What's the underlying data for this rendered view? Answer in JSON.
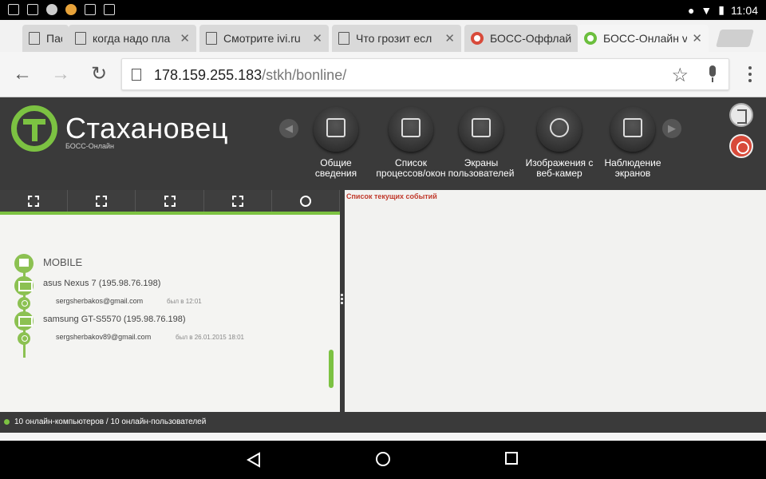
{
  "statusbar": {
    "time": "11:04"
  },
  "tabs": [
    {
      "title": "Пас",
      "active": false,
      "favicon": "page-icon"
    },
    {
      "title": "когда надо пла",
      "active": false,
      "favicon": "page-icon"
    },
    {
      "title": "Смотрите ivi.ru",
      "active": false,
      "favicon": "page-icon"
    },
    {
      "title": "Что грозит есл",
      "active": false,
      "favicon": "page-icon"
    },
    {
      "title": "БОСС-Оффлайн",
      "active": false,
      "favicon": "boss-icon"
    },
    {
      "title": "БОСС-Онлайн v",
      "active": true,
      "favicon": "boss-icon"
    }
  ],
  "toolbar": {
    "url_host": "178.159.255.183",
    "url_path": "/stkh/bonline/"
  },
  "header": {
    "logo_name": "Стахановец",
    "logo_sub": "БОСС-Онлайн",
    "nav": [
      {
        "label": "Общие сведения",
        "icon": "info-icon"
      },
      {
        "label": "Список процессов/окон",
        "icon": "list-icon"
      },
      {
        "label": "Экраны пользователей",
        "icon": "screens-icon"
      },
      {
        "label": "Изображения с веб-камер",
        "icon": "webcam-icon"
      },
      {
        "label": "Наблюдение экранов",
        "icon": "eye-monitor-icon"
      }
    ]
  },
  "tree": {
    "root": "MOBILE",
    "devices": [
      {
        "name": "asus Nexus 7 (195.98.76.198)",
        "user": "sergsherbakos@gmail.com",
        "status": "был в 12:01"
      },
      {
        "name": "samsung GT-S5570 (195.98.76.198)",
        "user": "sergsherbakov89@gmail.com",
        "status": "был в 26.01.2015 18:01"
      }
    ]
  },
  "events": {
    "title": "Список текущих событий"
  },
  "footer": {
    "status": "10 онлайн-компьютеров / 10 онлайн-пользователей"
  },
  "colors": {
    "accent": "#7cc242",
    "header_bg": "#3a3a3a",
    "event_title": "#c0392b"
  }
}
